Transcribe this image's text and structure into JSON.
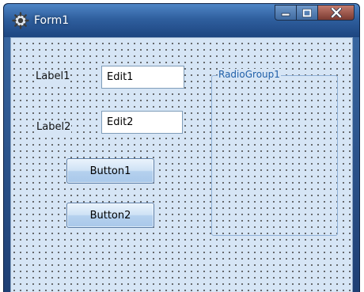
{
  "window": {
    "title": "Form1",
    "icon": "gear-app-icon",
    "controls": [
      "minimize-icon",
      "maximize-icon",
      "close-icon"
    ]
  },
  "form": {
    "label1": "Label1",
    "label2": "Label2",
    "edit1": "Edit1",
    "edit2": "Edit2",
    "button1": "Button1",
    "button2": "Button2",
    "radiogroup_caption": "RadioGroup1"
  },
  "colors": {
    "titlebar": "#2f5f9e",
    "client_background": "#d6e5f5",
    "groupbox_caption": "#1f5fa8",
    "close_button": "#a9473b"
  }
}
